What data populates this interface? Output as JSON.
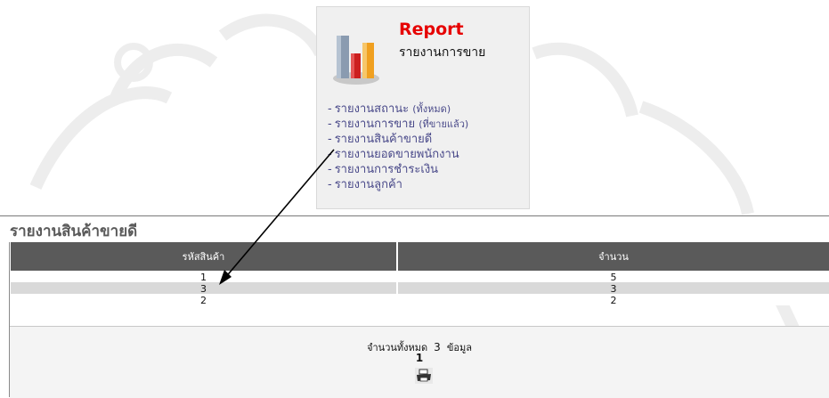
{
  "report_card": {
    "title": "Report",
    "subtitle": "รายงานการขาย",
    "icon": "bar-chart-icon",
    "menu": [
      {
        "label": "รายงานสถานะ",
        "note": "(ทั้งหมด)"
      },
      {
        "label": "รายงานการขาย",
        "note": "(ที่ขายแล้ว)"
      },
      {
        "label": "รายงานสินค้าขายดี",
        "note": ""
      },
      {
        "label": "รายงานยอดขายพนักงาน",
        "note": ""
      },
      {
        "label": "รายงานการชำระเงิน",
        "note": ""
      },
      {
        "label": "รายงานลูกค้า",
        "note": ""
      }
    ]
  },
  "section": {
    "title": "รายงานสินค้าขายดี"
  },
  "table": {
    "headers": [
      "รหัสสินค้า",
      "จำนวน"
    ],
    "rows": [
      [
        "1",
        "5"
      ],
      [
        "3",
        "3"
      ],
      [
        "2",
        "2"
      ]
    ]
  },
  "footer": {
    "total_label": "จำนวนทั้งหมด",
    "total_value": "3",
    "total_unit": "ข้อมูล",
    "page": "1",
    "print_icon": "printer-icon"
  },
  "colors": {
    "title_red": "#e60000",
    "header_bg": "#5a5a5a",
    "link": "#4a4a8a"
  }
}
